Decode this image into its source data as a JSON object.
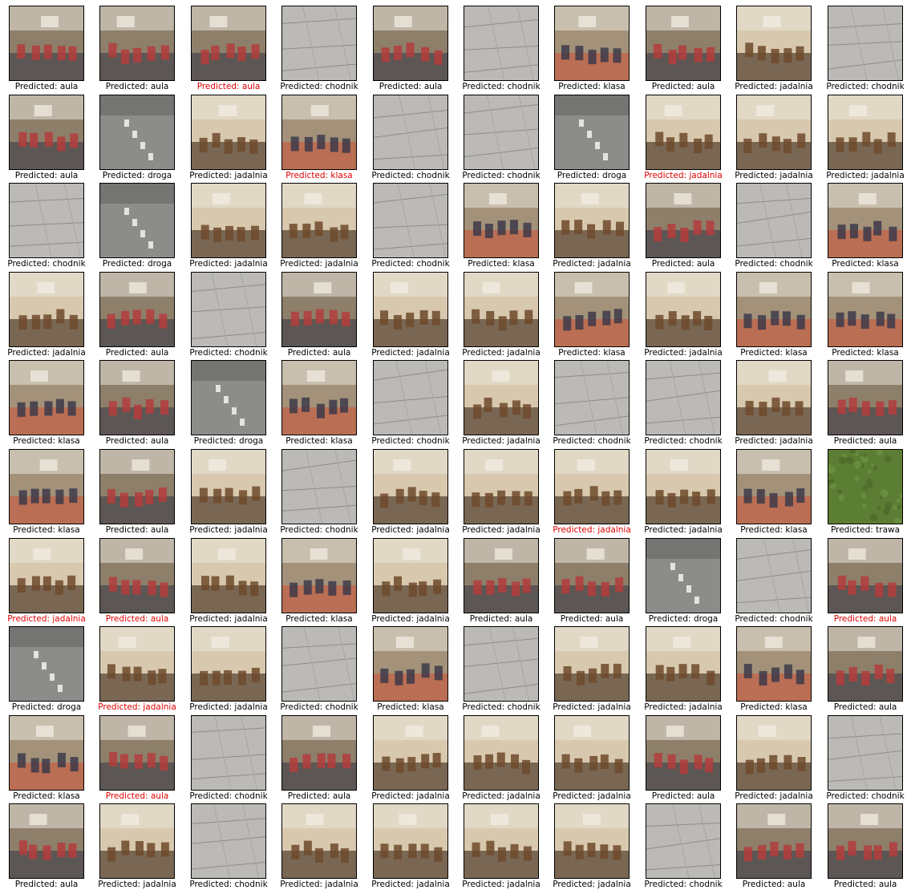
{
  "prefix": "Predicted: ",
  "colors": {
    "correct": "#000000",
    "incorrect": "#e00000"
  },
  "scene_palette": {
    "aula": [
      "#8d7f6a",
      "#b43c3c",
      "#3c3c46"
    ],
    "chodnik": [
      "#bcbab6",
      "#a8a6a1",
      "#8e8c88"
    ],
    "droga": [
      "#8c8c8a",
      "#747472",
      "#f2f2f0"
    ],
    "jadalnia": [
      "#d8c9ae",
      "#6e4a2c",
      "#3a2718"
    ],
    "klasa": [
      "#a39279",
      "#3d3a4a",
      "#c9573b"
    ],
    "trawa": [
      "#5c7e34",
      "#6f9443",
      "#4b6a2a"
    ]
  },
  "rows": [
    [
      {
        "label": "aula",
        "correct": true
      },
      {
        "label": "aula",
        "correct": true
      },
      {
        "label": "aula",
        "correct": false
      },
      {
        "label": "chodnik",
        "correct": true
      },
      {
        "label": "aula",
        "correct": true
      },
      {
        "label": "chodnik",
        "correct": true
      },
      {
        "label": "klasa",
        "correct": true
      },
      {
        "label": "aula",
        "correct": true
      },
      {
        "label": "jadalnia",
        "correct": true
      },
      {
        "label": "chodnik",
        "correct": true
      }
    ],
    [
      {
        "label": "aula",
        "correct": true
      },
      {
        "label": "droga",
        "correct": true
      },
      {
        "label": "jadalnia",
        "correct": true
      },
      {
        "label": "klasa",
        "correct": false
      },
      {
        "label": "chodnik",
        "correct": true
      },
      {
        "label": "chodnik",
        "correct": true
      },
      {
        "label": "droga",
        "correct": true
      },
      {
        "label": "jadalnia",
        "correct": false
      },
      {
        "label": "jadalnia",
        "correct": true
      },
      {
        "label": "jadalnia",
        "correct": true
      }
    ],
    [
      {
        "label": "chodnik",
        "correct": true
      },
      {
        "label": "droga",
        "correct": true
      },
      {
        "label": "jadalnia",
        "correct": true
      },
      {
        "label": "jadalnia",
        "correct": true
      },
      {
        "label": "chodnik",
        "correct": true
      },
      {
        "label": "klasa",
        "correct": true
      },
      {
        "label": "jadalnia",
        "correct": true
      },
      {
        "label": "aula",
        "correct": true
      },
      {
        "label": "chodnik",
        "correct": true
      },
      {
        "label": "klasa",
        "correct": true
      }
    ],
    [
      {
        "label": "jadalnia",
        "correct": true
      },
      {
        "label": "aula",
        "correct": true
      },
      {
        "label": "chodnik",
        "correct": true
      },
      {
        "label": "aula",
        "correct": true
      },
      {
        "label": "jadalnia",
        "correct": true
      },
      {
        "label": "jadalnia",
        "correct": true
      },
      {
        "label": "klasa",
        "correct": true
      },
      {
        "label": "jadalnia",
        "correct": true
      },
      {
        "label": "klasa",
        "correct": true
      },
      {
        "label": "klasa",
        "correct": true
      }
    ],
    [
      {
        "label": "klasa",
        "correct": true
      },
      {
        "label": "aula",
        "correct": true
      },
      {
        "label": "droga",
        "correct": true
      },
      {
        "label": "klasa",
        "correct": true
      },
      {
        "label": "chodnik",
        "correct": true
      },
      {
        "label": "jadalnia",
        "correct": true
      },
      {
        "label": "chodnik",
        "correct": true
      },
      {
        "label": "chodnik",
        "correct": true
      },
      {
        "label": "jadalnia",
        "correct": true
      },
      {
        "label": "aula",
        "correct": true
      }
    ],
    [
      {
        "label": "klasa",
        "correct": true
      },
      {
        "label": "aula",
        "correct": true
      },
      {
        "label": "jadalnia",
        "correct": true
      },
      {
        "label": "chodnik",
        "correct": true
      },
      {
        "label": "jadalnia",
        "correct": true
      },
      {
        "label": "jadalnia",
        "correct": true
      },
      {
        "label": "jadalnia",
        "correct": false
      },
      {
        "label": "jadalnia",
        "correct": true
      },
      {
        "label": "klasa",
        "correct": true
      },
      {
        "label": "trawa",
        "correct": true
      }
    ],
    [
      {
        "label": "jadalnia",
        "correct": false
      },
      {
        "label": "aula",
        "correct": false
      },
      {
        "label": "jadalnia",
        "correct": true
      },
      {
        "label": "klasa",
        "correct": true
      },
      {
        "label": "jadalnia",
        "correct": true
      },
      {
        "label": "aula",
        "correct": true
      },
      {
        "label": "aula",
        "correct": true
      },
      {
        "label": "droga",
        "correct": true
      },
      {
        "label": "chodnik",
        "correct": true
      },
      {
        "label": "aula",
        "correct": false
      }
    ],
    [
      {
        "label": "droga",
        "correct": true
      },
      {
        "label": "jadalnia",
        "correct": false
      },
      {
        "label": "jadalnia",
        "correct": true
      },
      {
        "label": "chodnik",
        "correct": true
      },
      {
        "label": "klasa",
        "correct": true
      },
      {
        "label": "chodnik",
        "correct": true
      },
      {
        "label": "jadalnia",
        "correct": true
      },
      {
        "label": "jadalnia",
        "correct": true
      },
      {
        "label": "klasa",
        "correct": true
      },
      {
        "label": "aula",
        "correct": true
      }
    ],
    [
      {
        "label": "klasa",
        "correct": true
      },
      {
        "label": "aula",
        "correct": false
      },
      {
        "label": "chodnik",
        "correct": true
      },
      {
        "label": "aula",
        "correct": true
      },
      {
        "label": "jadalnia",
        "correct": true
      },
      {
        "label": "jadalnia",
        "correct": true
      },
      {
        "label": "jadalnia",
        "correct": true
      },
      {
        "label": "aula",
        "correct": true
      },
      {
        "label": "jadalnia",
        "correct": true
      },
      {
        "label": "chodnik",
        "correct": true
      }
    ],
    [
      {
        "label": "aula",
        "correct": true
      },
      {
        "label": "jadalnia",
        "correct": true
      },
      {
        "label": "chodnik",
        "correct": true
      },
      {
        "label": "jadalnia",
        "correct": true
      },
      {
        "label": "jadalnia",
        "correct": true
      },
      {
        "label": "jadalnia",
        "correct": true
      },
      {
        "label": "jadalnia",
        "correct": true
      },
      {
        "label": "chodnik",
        "correct": true
      },
      {
        "label": "aula",
        "correct": true
      },
      {
        "label": "aula",
        "correct": true
      }
    ]
  ]
}
